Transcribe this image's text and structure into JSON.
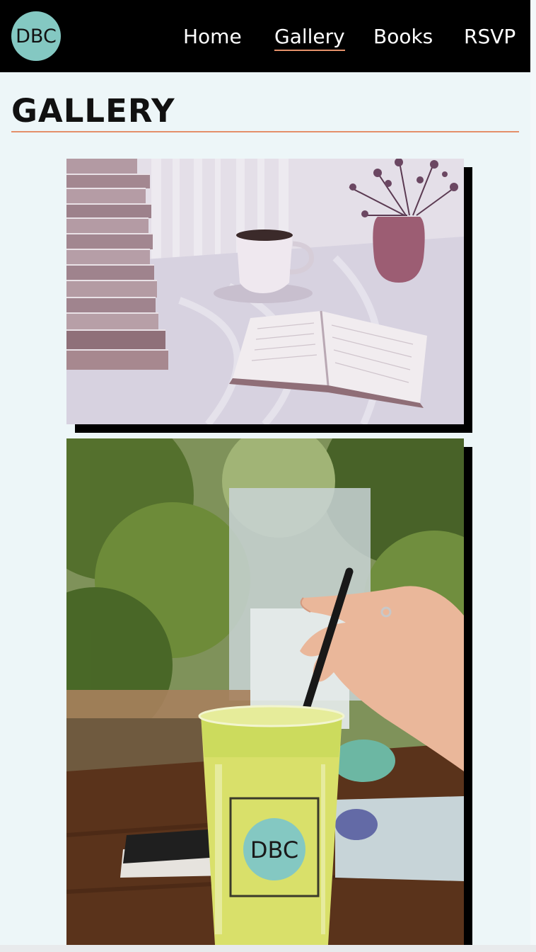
{
  "nav": {
    "logo_text": "DBC",
    "links": [
      {
        "label": "Home",
        "active": false
      },
      {
        "label": "Gallery",
        "active": true
      },
      {
        "label": "Books",
        "active": false
      },
      {
        "label": "RSVP",
        "active": false
      }
    ]
  },
  "page": {
    "title": "GALLERY",
    "accent_color": "#e4906a",
    "logo_color": "#84c8c2"
  },
  "gallery": {
    "photos": [
      {
        "name": "reading-table-photo"
      },
      {
        "name": "green-drink-photo",
        "cup_logo_text": "DBC"
      }
    ]
  }
}
